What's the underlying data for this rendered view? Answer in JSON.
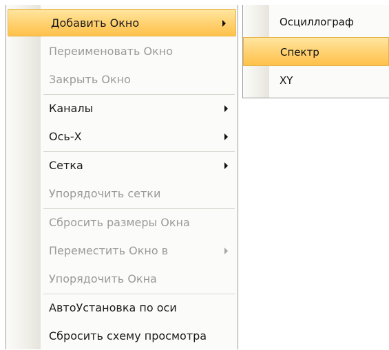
{
  "context_menu": {
    "items": [
      {
        "label": "Добавить Окно",
        "enabled": true,
        "submenu": true,
        "highlighted": true
      },
      {
        "label": "Переименовать Окно",
        "enabled": false
      },
      {
        "label": "Закрыть Окно",
        "enabled": false
      },
      {
        "label": "Каналы",
        "enabled": true,
        "submenu": true
      },
      {
        "label": "Ось-X",
        "enabled": true,
        "submenu": true
      },
      {
        "label": "Сетка",
        "enabled": true,
        "submenu": true
      },
      {
        "label": "Упорядочить сетки",
        "enabled": false
      },
      {
        "label": "Сбросить размеры Окна",
        "enabled": false
      },
      {
        "label": "Переместить Окно в",
        "enabled": false,
        "submenu": true
      },
      {
        "label": "Упорядочить Окна",
        "enabled": false
      },
      {
        "label": "АвтоУстановка по оси",
        "enabled": true
      },
      {
        "label": "Сбросить схему просмотра",
        "enabled": true
      }
    ]
  },
  "submenu_add_window": {
    "items": [
      {
        "label": "Осциллограф"
      },
      {
        "label": "Спектр",
        "highlighted": true
      },
      {
        "label": "XY"
      }
    ]
  },
  "colors": {
    "highlight": "#ffd477",
    "disabled_text": "#9a9a9a",
    "text": "#1b1b1b"
  }
}
